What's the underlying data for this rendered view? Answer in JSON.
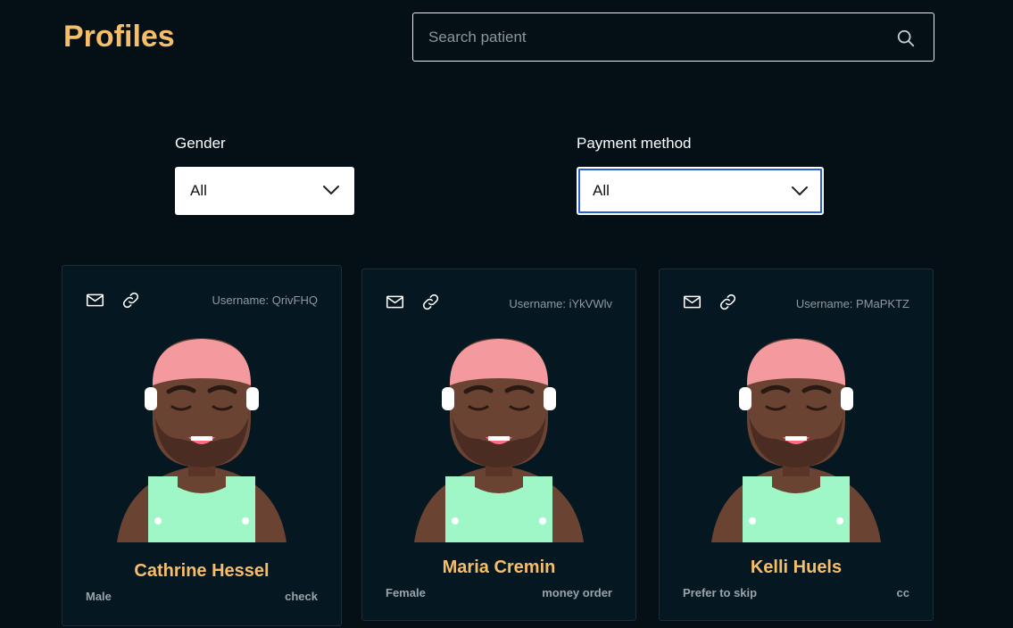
{
  "header": {
    "title": "Profiles"
  },
  "search": {
    "placeholder": "Search patient",
    "value": ""
  },
  "filters": {
    "gender": {
      "label": "Gender",
      "selected": "All"
    },
    "payment": {
      "label": "Payment method",
      "selected": "All"
    }
  },
  "colors": {
    "accent": "#f7be6a",
    "background": "#050f16",
    "card": "#051822",
    "focus_outline": "#2a5fd3"
  },
  "patients": [
    {
      "username": "Username: QrivFHQ",
      "name": "Cathrine Hessel",
      "gender": "Male",
      "payment": "check"
    },
    {
      "username": "Username: iYkVWlv",
      "name": "Maria Cremin",
      "gender": "Female",
      "payment": "money order"
    },
    {
      "username": "Username: PMaPKTZ",
      "name": "Kelli Huels",
      "gender": "Prefer to skip",
      "payment": "cc"
    }
  ],
  "icons": {
    "email": "mail-icon",
    "link": "link-icon",
    "search": "search-icon",
    "dropdown": "chevron-down-icon",
    "avatar": "avatar-illustration"
  }
}
